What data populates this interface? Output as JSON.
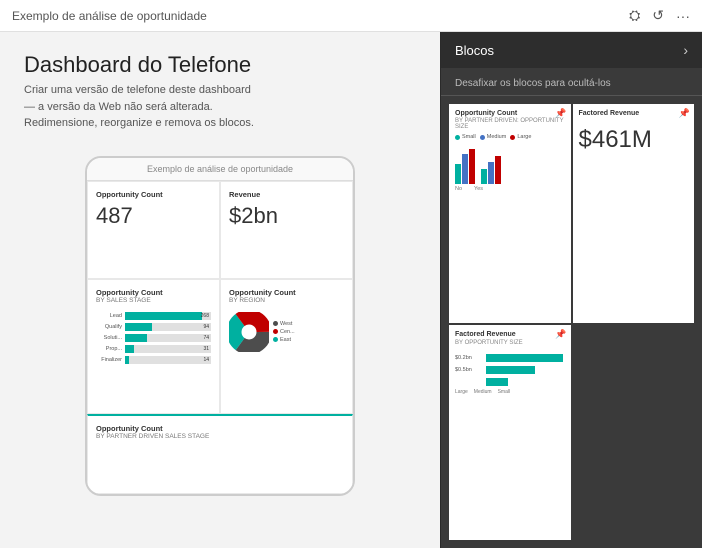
{
  "topbar": {
    "title": "Exemplo de análise de oportunidade",
    "icons": [
      "settings",
      "undo",
      "more"
    ]
  },
  "left": {
    "heading": "Dashboard do Telefone",
    "description": "Criar uma versão de telefone deste dashboard — a versão da Web não será alterada. Redimensione, reorganize e remova os blocos.",
    "phone": {
      "watermark": "Exemplo de análise de oportunidade",
      "tiles": [
        {
          "id": "opp-count",
          "title": "Opportunity Count",
          "subtitle": "",
          "value": "487"
        },
        {
          "id": "revenue",
          "title": "Revenue",
          "subtitle": "",
          "value": "$2bn"
        },
        {
          "id": "opp-count-stage",
          "title": "Opportunity Count",
          "subtitle": "BY SALES STAGE",
          "chart": "bars",
          "bars": [
            {
              "label": "Lead",
              "value": 268,
              "max": 300,
              "color": "#00b0a0"
            },
            {
              "label": "Qualify",
              "value": 94,
              "max": 300,
              "color": "#00b0a0"
            },
            {
              "label": "Soluti...",
              "value": 74,
              "max": 300,
              "color": "#00b0a0"
            },
            {
              "label": "Prop...",
              "value": 31,
              "max": 300,
              "color": "#00b0a0"
            },
            {
              "label": "Finalizer",
              "value": 14,
              "max": 300,
              "color": "#00b0a0"
            }
          ]
        },
        {
          "id": "opp-count-region",
          "title": "Opportunity Count",
          "subtitle": "BY REGION",
          "chart": "pie",
          "segments": [
            {
              "label": "West",
              "value": 35,
              "color": "#4d4d4d"
            },
            {
              "label": "East",
              "value": 30,
              "color": "#00b0a0"
            },
            {
              "label": "Cen...",
              "value": 35,
              "color": "#ff6b6b"
            }
          ]
        }
      ],
      "bottom_tile": {
        "title": "Opportunity Count",
        "subtitle": "BY PARTNER DRIVEN SALES STAGE"
      }
    }
  },
  "right": {
    "panel_title": "Blocos",
    "panel_chevron": "›",
    "panel_desc": "Desafixar os blocos para ocultá-los",
    "blocks": [
      {
        "id": "block-opp-count",
        "title": "Opportunity Count",
        "subtitle": "BY PARTNER DRIVEN: OPPORTUNITY SIZE",
        "type": "bar-chart",
        "legend": [
          "Small",
          "Medium",
          "Large"
        ],
        "legend_colors": [
          "#00b0a0",
          "#4472c4",
          "#c00000"
        ]
      },
      {
        "id": "block-factored-revenue",
        "title": "Factored Revenue",
        "subtitle": "",
        "type": "value",
        "value": "$461M"
      },
      {
        "id": "block-factored-revenue-2",
        "title": "Factored Revenue",
        "subtitle": "BY OPPORTUNITY SIZE",
        "type": "bar-chart-2",
        "labels": [
          "Large",
          "Medium",
          "Small"
        ],
        "bar_color": "#00b0a0"
      }
    ]
  }
}
